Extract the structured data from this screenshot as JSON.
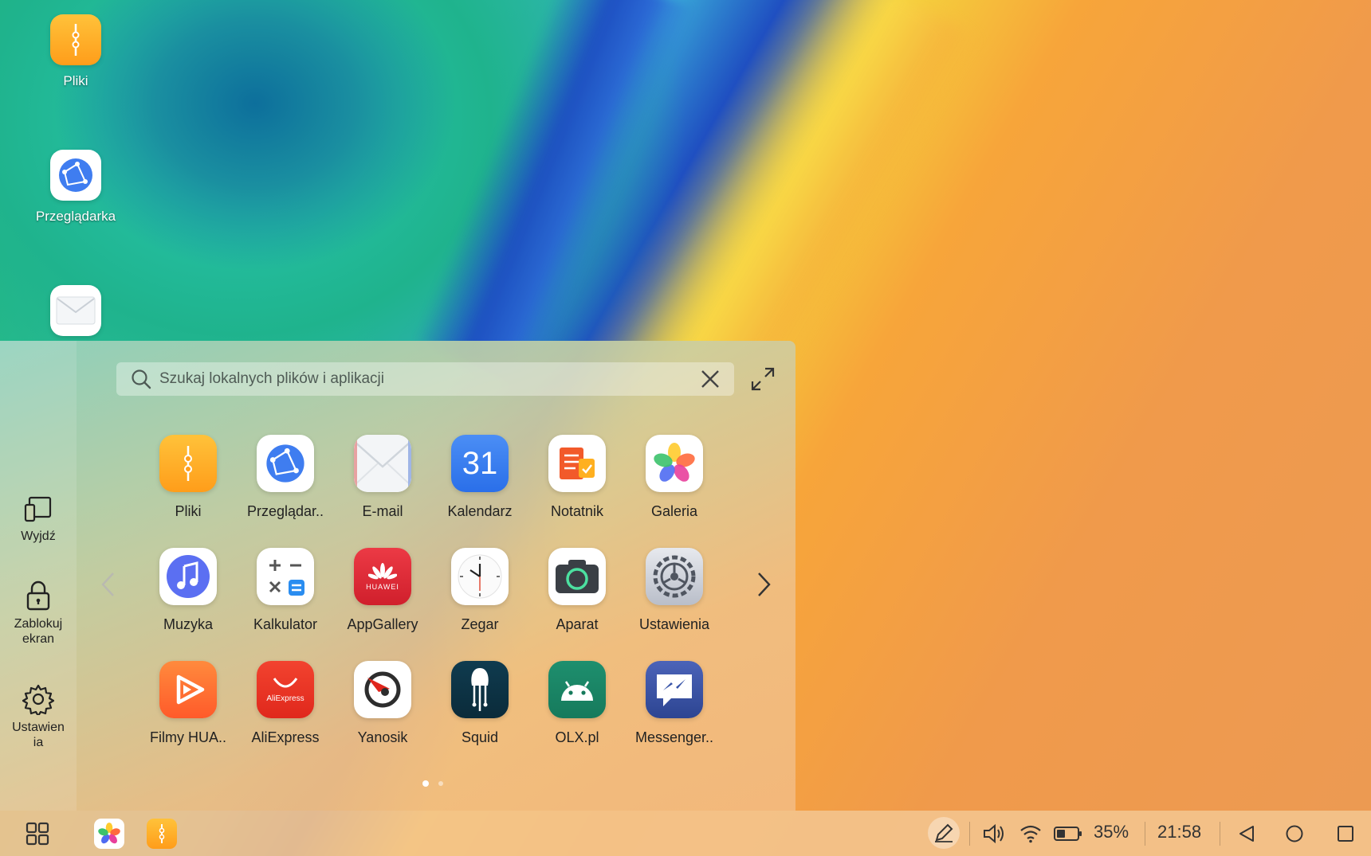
{
  "desktop": {
    "icons": [
      {
        "label": "Pliki",
        "icon": "files-icon"
      },
      {
        "label": "Przeglądarka",
        "icon": "browser-icon"
      },
      {
        "label": "",
        "icon": "email-icon"
      }
    ]
  },
  "sidebar": {
    "exit_label": "Wyjdź",
    "lock_label_1": "Zablokuj",
    "lock_label_2": "ekran",
    "settings_label_1": "Ustawien",
    "settings_label_2": "ia"
  },
  "search": {
    "placeholder": "Szukaj lokalnych plików i aplikacji"
  },
  "apps": [
    {
      "label": "Pliki"
    },
    {
      "label": "Przeglądar.."
    },
    {
      "label": "E-mail"
    },
    {
      "label": "Kalendarz"
    },
    {
      "label": "Notatnik"
    },
    {
      "label": "Galeria"
    },
    {
      "label": "Muzyka"
    },
    {
      "label": "Kalkulator"
    },
    {
      "label": "AppGallery"
    },
    {
      "label": "Zegar"
    },
    {
      "label": "Aparat"
    },
    {
      "label": "Ustawienia"
    },
    {
      "label": "Filmy HUA.."
    },
    {
      "label": "AliExpress"
    },
    {
      "label": "Yanosik"
    },
    {
      "label": "Squid"
    },
    {
      "label": "OLX.pl"
    },
    {
      "label": "Messenger.."
    }
  ],
  "icon_text": {
    "calendar_day": "31",
    "huawei": "HUAWEI",
    "aliexpress": "AliExpress"
  },
  "pager": {
    "current": 1,
    "total": 2
  },
  "taskbar": {
    "battery": "35%",
    "time": "21:58"
  }
}
